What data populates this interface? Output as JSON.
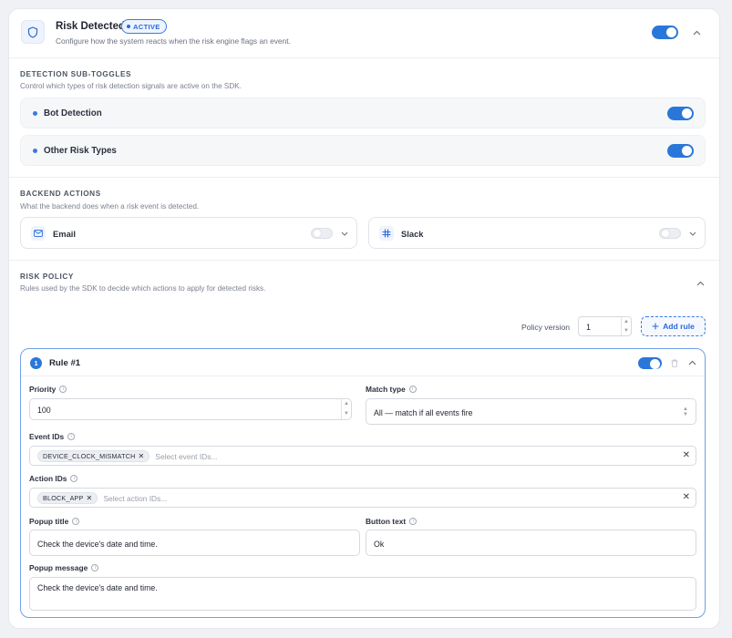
{
  "header": {
    "title": "Risk Detected",
    "badge": "ACTIVE",
    "subtitle": "Configure how the system reacts when the risk engine flags an event.",
    "enabled": true
  },
  "detection": {
    "label": "DETECTION SUB-TOGGLES",
    "description": "Control which types of risk detection signals are active on the SDK.",
    "items": [
      {
        "label": "Bot Detection",
        "enabled": true
      },
      {
        "label": "Other Risk Types",
        "enabled": true
      }
    ]
  },
  "backend": {
    "label": "BACKEND ACTIONS",
    "description": "What the backend does when a risk event is detected.",
    "actions": [
      {
        "label": "Email",
        "icon": "mail-icon",
        "enabled": false
      },
      {
        "label": "Slack",
        "icon": "slack-icon",
        "enabled": false
      }
    ]
  },
  "policy": {
    "label": "RISK POLICY",
    "description": "Rules used by the SDK to decide which actions to apply for detected risks.",
    "version_label": "Policy version",
    "version_value": "1",
    "add_rule_label": "Add rule"
  },
  "rule": {
    "number": "1",
    "title": "Rule #1",
    "enabled": true,
    "priority_label": "Priority",
    "priority_value": "100",
    "match_type_label": "Match type",
    "match_type_value": "All — match if all events fire",
    "event_ids_label": "Event IDs",
    "event_ids": [
      "DEVICE_CLOCK_MISMATCH"
    ],
    "event_ids_placeholder": "Select event IDs...",
    "action_ids_label": "Action IDs",
    "action_ids": [
      "BLOCK_APP"
    ],
    "action_ids_placeholder": "Select action IDs...",
    "popup_title_label": "Popup title",
    "popup_title_value": "Check the device's date and time.",
    "button_text_label": "Button text",
    "button_text_value": "Ok",
    "popup_message_label": "Popup message",
    "popup_message_value": "Check the device's date and time."
  },
  "colors": {
    "accent": "#2a77d9",
    "background": "#f0f1f4",
    "panel": "#ffffff"
  }
}
